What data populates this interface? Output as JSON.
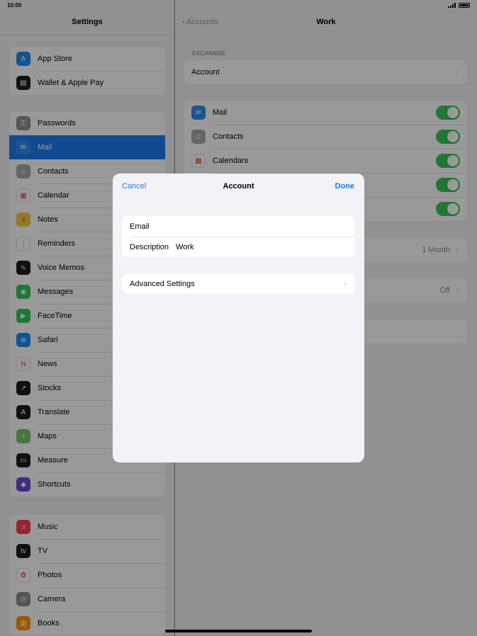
{
  "status": {
    "time": "10:00"
  },
  "sidebar": {
    "title": "Settings",
    "group1": [
      {
        "label": "App Store",
        "icon": "app-store-icon",
        "color": "#1a8cf5",
        "glyph": "A"
      },
      {
        "label": "Wallet & Apple Pay",
        "icon": "wallet-icon",
        "color": "#1c1c1e",
        "glyph": "▤"
      }
    ],
    "group2": [
      {
        "label": "Passwords",
        "icon": "key-icon",
        "color": "#8e8e93",
        "glyph": "⚿"
      },
      {
        "label": "Mail",
        "icon": "mail-icon",
        "color": "#2f8cf3",
        "glyph": "✉"
      },
      {
        "label": "Contacts",
        "icon": "contacts-icon",
        "color": "#a8a8ad",
        "glyph": "☺"
      },
      {
        "label": "Calendar",
        "icon": "calendar-icon",
        "color": "#ffffff",
        "glyph": "▦"
      },
      {
        "label": "Notes",
        "icon": "notes-icon",
        "color": "#f7c843",
        "glyph": "≡"
      },
      {
        "label": "Reminders",
        "icon": "reminders-icon",
        "color": "#ffffff",
        "glyph": "⋮"
      },
      {
        "label": "Voice Memos",
        "icon": "voice-memos-icon",
        "color": "#1c1c1e",
        "glyph": "∿"
      },
      {
        "label": "Messages",
        "icon": "messages-icon",
        "color": "#34c759",
        "glyph": "◉"
      },
      {
        "label": "FaceTime",
        "icon": "facetime-icon",
        "color": "#34c759",
        "glyph": "▶"
      },
      {
        "label": "Safari",
        "icon": "safari-icon",
        "color": "#1a8cf5",
        "glyph": "⊕"
      },
      {
        "label": "News",
        "icon": "news-icon",
        "color": "#ffffff",
        "glyph": "N"
      },
      {
        "label": "Stocks",
        "icon": "stocks-icon",
        "color": "#1c1c1e",
        "glyph": "↗"
      },
      {
        "label": "Translate",
        "icon": "translate-icon",
        "color": "#1c1c1e",
        "glyph": "A"
      },
      {
        "label": "Maps",
        "icon": "maps-icon",
        "color": "#7ac36a",
        "glyph": "⌖"
      },
      {
        "label": "Measure",
        "icon": "measure-icon",
        "color": "#1c1c1e",
        "glyph": "▭"
      },
      {
        "label": "Shortcuts",
        "icon": "shortcuts-icon",
        "color": "#6b4bd8",
        "glyph": "◆"
      }
    ],
    "group3": [
      {
        "label": "Music",
        "icon": "music-icon",
        "color": "#fa3c50",
        "glyph": "♫"
      },
      {
        "label": "TV",
        "icon": "tv-icon",
        "color": "#1c1c1e",
        "glyph": "tv"
      },
      {
        "label": "Photos",
        "icon": "photos-icon",
        "color": "#ffffff",
        "glyph": "✿"
      },
      {
        "label": "Camera",
        "icon": "camera-icon",
        "color": "#8e8e93",
        "glyph": "◎"
      },
      {
        "label": "Books",
        "icon": "books-icon",
        "color": "#ff9500",
        "glyph": "▥"
      }
    ],
    "selected": "Mail"
  },
  "detail": {
    "back_label": "Accounts",
    "title": "Work",
    "section_header": "EXCHANGE",
    "account_label": "Account",
    "toggles": [
      {
        "label": "Mail",
        "icon": "mail-icon",
        "color": "#2f8cf3",
        "glyph": "✉",
        "on": true
      },
      {
        "label": "Contacts",
        "icon": "contacts-icon",
        "color": "#a8a8ad",
        "glyph": "☺",
        "on": true
      },
      {
        "label": "Calendars",
        "icon": "calendar-icon",
        "color": "#ffffff",
        "glyph": "▦",
        "on": true
      },
      {
        "label": "",
        "on": true
      },
      {
        "label": "",
        "on": true
      }
    ],
    "mail_days_value": "1 Month",
    "auto_reply_value": "Off"
  },
  "modal": {
    "cancel_label": "Cancel",
    "title": "Account",
    "done_label": "Done",
    "email_label": "Email",
    "email_value": "",
    "description_label": "Description",
    "description_value": "Work",
    "advanced_label": "Advanced Settings"
  }
}
